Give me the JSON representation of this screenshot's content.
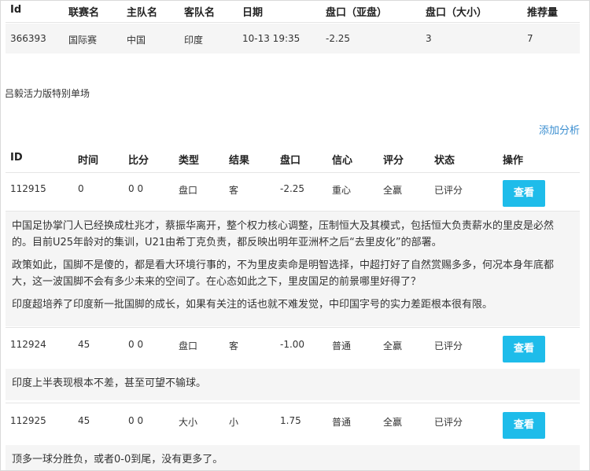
{
  "match_table": {
    "headers": [
      "Id",
      "联赛名",
      "主队名",
      "客队名",
      "日期",
      "盘口（亚盘）",
      "盘口（大小）",
      "推荐量"
    ],
    "row": [
      "366393",
      "国际赛",
      "中国",
      "印度",
      "10-13 19:35",
      "-2.25",
      "3",
      "7"
    ]
  },
  "special_title": "吕毅活力版特别单场",
  "add_analysis_label": "添加分析",
  "analysis_table": {
    "headers": [
      "ID",
      "时间",
      "比分",
      "类型",
      "结果",
      "盘口",
      "信心",
      "评分",
      "状态",
      "操作"
    ],
    "rows": [
      {
        "cells": [
          "112915",
          "0",
          "0 0",
          "盘口",
          "客",
          "-2.25",
          "重心",
          "全赢",
          "已评分"
        ],
        "action": "查看",
        "paragraphs": [
          "中国足协掌门人已经换成杜兆才，蔡振华离开，整个权力核心调整，压制恒大及其模式，包括恒大负责薪水的里皮是必然的。目前U25年龄对的集训，U21由希丁克负责，都反映出明年亚洲杯之后“去里皮化”的部署。",
          "政策如此，国脚不是傻的，都是看大环境行事的，不为里皮卖命是明智选择，中超打好了自然赏赐多多，何况本身年底都大，这一波国脚不会有多少未来的空间了。在心态如此之下，里皮国足的前景哪里好得了？",
          "印度超培养了印度新一批国脚的成长，如果有关注的话也就不难发觉，中印国字号的实力差距根本很有限。"
        ]
      },
      {
        "cells": [
          "112924",
          "45",
          "0 0",
          "盘口",
          "客",
          "-1.00",
          "普通",
          "全赢",
          "已评分"
        ],
        "action": "查看",
        "paragraphs": [
          "印度上半表现根本不差，甚至可望不输球。"
        ]
      },
      {
        "cells": [
          "112925",
          "45",
          "0 0",
          "大小",
          "小",
          "1.75",
          "普通",
          "全赢",
          "已评分"
        ],
        "action": "查看",
        "paragraphs": [
          "顶多一球分胜负，或者0-0到尾，没有更多了。"
        ]
      }
    ]
  },
  "colors": {
    "button": "#1ebcea",
    "link": "#3a8ed0",
    "row_band": "#f5f5f5"
  }
}
